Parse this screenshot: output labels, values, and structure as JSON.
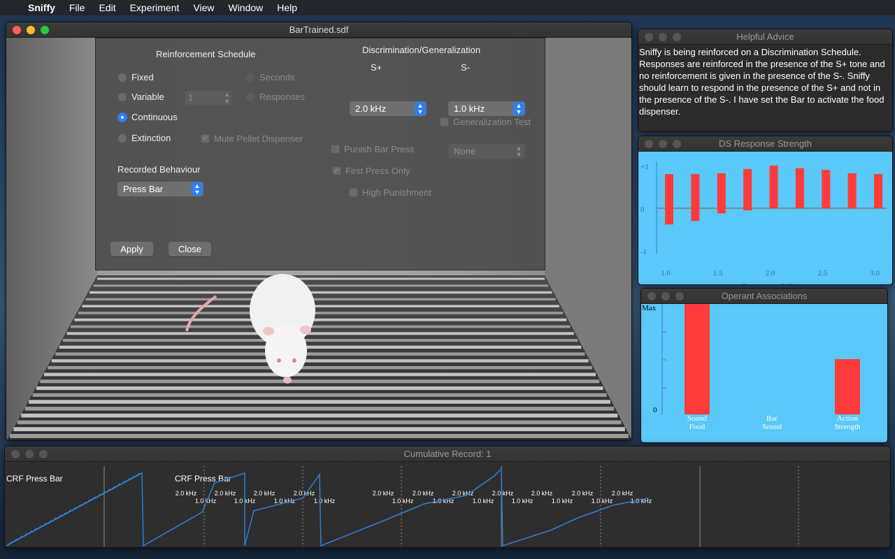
{
  "menubar": {
    "apple_icon": "apple-icon",
    "app_name": "Sniffy",
    "items": [
      "File",
      "Edit",
      "Experiment",
      "View",
      "Window",
      "Help"
    ]
  },
  "main_window": {
    "title": "BarTrained.sdf"
  },
  "settings": {
    "reinforcement_heading": "Reinforcement Schedule",
    "schedule_options": [
      {
        "label": "Fixed",
        "selected": false
      },
      {
        "label": "Variable",
        "selected": false
      },
      {
        "label": "Continuous",
        "selected": true
      },
      {
        "label": "Extinction",
        "selected": false
      }
    ],
    "unit_options": [
      {
        "label": "Seconds",
        "selected": false
      },
      {
        "label": "Responses",
        "selected": true
      }
    ],
    "interval_value": "1",
    "mute_pellet_label": "Mute Pellet Dispenser",
    "mute_pellet_checked": true,
    "recorded_heading": "Recorded Behaviour",
    "recorded_value": "Press Bar",
    "discrimination_heading": "Discrimination/Generalization",
    "s_plus_label": "S+",
    "s_minus_label": "S-",
    "s_plus_value": "2.0 kHz",
    "s_minus_value": "1.0 kHz",
    "generalization_label": "Generalization Test",
    "punish_label": "Punish Bar Press",
    "punish_value": "None",
    "first_press_label": "First Press Only",
    "first_press_checked": true,
    "high_punishment_label": "High Punishment",
    "apply_label": "Apply",
    "close_label": "Close"
  },
  "advice": {
    "title": "Helpful Advice",
    "text": "Sniffy is being reinforced on a Discrimination Schedule. Responses are reinforced in the presence of the S+ tone and no reinforcement is given in the presence of the S-. Sniffy should learn to respond in the presence of the S+ and not in the presence of the S-. I have set the Bar to activate the food dispenser."
  },
  "ds_strength": {
    "title": "DS Response Strength",
    "y_ticks": [
      "+1",
      "0",
      "-1"
    ],
    "x_ticks": [
      "1.0",
      "1.5",
      "2.0",
      "2.5",
      "3.0"
    ],
    "xlabel": "Frequency (kHz)",
    "bar_color": "#ff3b3b",
    "bg_color": "#5ac8f8"
  },
  "operant": {
    "title": "Operant Associations",
    "y_ticks": [
      "Max",
      "0"
    ],
    "categories": [
      {
        "line1": "Sound",
        "line2": "Food"
      },
      {
        "line1": "Bar",
        "line2": "Sound"
      },
      {
        "line1": "Action",
        "line2": "Strength"
      }
    ],
    "bar_color": "#ff3b3b"
  },
  "cumulative": {
    "title": "Cumulative Record: 1",
    "label1": "CRF Press Bar",
    "label2": "CRF Press Bar",
    "s_plus": "2.0 kHz",
    "s_minus": "1.0 kHz",
    "line_color": "#2f7fd6"
  },
  "chart_data": [
    {
      "type": "bar",
      "title": "DS Response Strength",
      "xlabel": "Frequency (kHz)",
      "ylabel": "",
      "ylim": [
        -1,
        1
      ],
      "x": [
        1.0,
        1.25,
        1.5,
        1.75,
        2.0,
        2.25,
        2.5,
        2.75,
        3.0
      ],
      "series": [
        {
          "name": "",
          "low": [
            -0.38,
            -0.3,
            -0.12,
            -0.05,
            0.0,
            0.0,
            0.0,
            0.0,
            0.0
          ],
          "high": [
            0.8,
            0.8,
            0.82,
            0.92,
            1.0,
            0.94,
            0.9,
            0.82,
            0.8
          ]
        }
      ]
    },
    {
      "type": "bar",
      "title": "Operant Associations",
      "categories": [
        "Sound Food",
        "Bar Sound",
        "Action Strength"
      ],
      "values": [
        1.0,
        0.0,
        0.5
      ],
      "ylim": [
        0,
        1
      ]
    }
  ]
}
